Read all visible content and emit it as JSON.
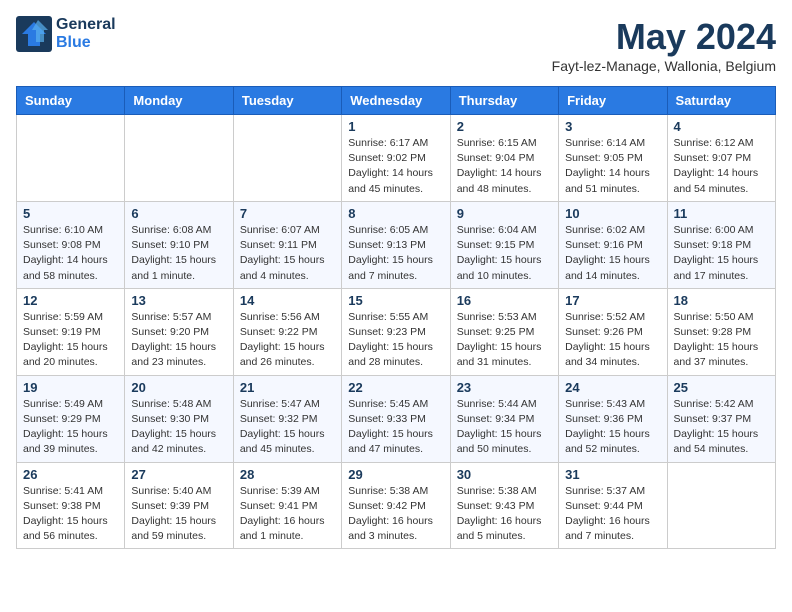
{
  "header": {
    "logo_general": "General",
    "logo_blue": "Blue",
    "month_title": "May 2024",
    "location": "Fayt-lez-Manage, Wallonia, Belgium"
  },
  "days_of_week": [
    "Sunday",
    "Monday",
    "Tuesday",
    "Wednesday",
    "Thursday",
    "Friday",
    "Saturday"
  ],
  "weeks": [
    [
      {
        "day": "",
        "info": ""
      },
      {
        "day": "",
        "info": ""
      },
      {
        "day": "",
        "info": ""
      },
      {
        "day": "1",
        "info": "Sunrise: 6:17 AM\nSunset: 9:02 PM\nDaylight: 14 hours\nand 45 minutes."
      },
      {
        "day": "2",
        "info": "Sunrise: 6:15 AM\nSunset: 9:04 PM\nDaylight: 14 hours\nand 48 minutes."
      },
      {
        "day": "3",
        "info": "Sunrise: 6:14 AM\nSunset: 9:05 PM\nDaylight: 14 hours\nand 51 minutes."
      },
      {
        "day": "4",
        "info": "Sunrise: 6:12 AM\nSunset: 9:07 PM\nDaylight: 14 hours\nand 54 minutes."
      }
    ],
    [
      {
        "day": "5",
        "info": "Sunrise: 6:10 AM\nSunset: 9:08 PM\nDaylight: 14 hours\nand 58 minutes."
      },
      {
        "day": "6",
        "info": "Sunrise: 6:08 AM\nSunset: 9:10 PM\nDaylight: 15 hours\nand 1 minute."
      },
      {
        "day": "7",
        "info": "Sunrise: 6:07 AM\nSunset: 9:11 PM\nDaylight: 15 hours\nand 4 minutes."
      },
      {
        "day": "8",
        "info": "Sunrise: 6:05 AM\nSunset: 9:13 PM\nDaylight: 15 hours\nand 7 minutes."
      },
      {
        "day": "9",
        "info": "Sunrise: 6:04 AM\nSunset: 9:15 PM\nDaylight: 15 hours\nand 10 minutes."
      },
      {
        "day": "10",
        "info": "Sunrise: 6:02 AM\nSunset: 9:16 PM\nDaylight: 15 hours\nand 14 minutes."
      },
      {
        "day": "11",
        "info": "Sunrise: 6:00 AM\nSunset: 9:18 PM\nDaylight: 15 hours\nand 17 minutes."
      }
    ],
    [
      {
        "day": "12",
        "info": "Sunrise: 5:59 AM\nSunset: 9:19 PM\nDaylight: 15 hours\nand 20 minutes."
      },
      {
        "day": "13",
        "info": "Sunrise: 5:57 AM\nSunset: 9:20 PM\nDaylight: 15 hours\nand 23 minutes."
      },
      {
        "day": "14",
        "info": "Sunrise: 5:56 AM\nSunset: 9:22 PM\nDaylight: 15 hours\nand 26 minutes."
      },
      {
        "day": "15",
        "info": "Sunrise: 5:55 AM\nSunset: 9:23 PM\nDaylight: 15 hours\nand 28 minutes."
      },
      {
        "day": "16",
        "info": "Sunrise: 5:53 AM\nSunset: 9:25 PM\nDaylight: 15 hours\nand 31 minutes."
      },
      {
        "day": "17",
        "info": "Sunrise: 5:52 AM\nSunset: 9:26 PM\nDaylight: 15 hours\nand 34 minutes."
      },
      {
        "day": "18",
        "info": "Sunrise: 5:50 AM\nSunset: 9:28 PM\nDaylight: 15 hours\nand 37 minutes."
      }
    ],
    [
      {
        "day": "19",
        "info": "Sunrise: 5:49 AM\nSunset: 9:29 PM\nDaylight: 15 hours\nand 39 minutes."
      },
      {
        "day": "20",
        "info": "Sunrise: 5:48 AM\nSunset: 9:30 PM\nDaylight: 15 hours\nand 42 minutes."
      },
      {
        "day": "21",
        "info": "Sunrise: 5:47 AM\nSunset: 9:32 PM\nDaylight: 15 hours\nand 45 minutes."
      },
      {
        "day": "22",
        "info": "Sunrise: 5:45 AM\nSunset: 9:33 PM\nDaylight: 15 hours\nand 47 minutes."
      },
      {
        "day": "23",
        "info": "Sunrise: 5:44 AM\nSunset: 9:34 PM\nDaylight: 15 hours\nand 50 minutes."
      },
      {
        "day": "24",
        "info": "Sunrise: 5:43 AM\nSunset: 9:36 PM\nDaylight: 15 hours\nand 52 minutes."
      },
      {
        "day": "25",
        "info": "Sunrise: 5:42 AM\nSunset: 9:37 PM\nDaylight: 15 hours\nand 54 minutes."
      }
    ],
    [
      {
        "day": "26",
        "info": "Sunrise: 5:41 AM\nSunset: 9:38 PM\nDaylight: 15 hours\nand 56 minutes."
      },
      {
        "day": "27",
        "info": "Sunrise: 5:40 AM\nSunset: 9:39 PM\nDaylight: 15 hours\nand 59 minutes."
      },
      {
        "day": "28",
        "info": "Sunrise: 5:39 AM\nSunset: 9:41 PM\nDaylight: 16 hours\nand 1 minute."
      },
      {
        "day": "29",
        "info": "Sunrise: 5:38 AM\nSunset: 9:42 PM\nDaylight: 16 hours\nand 3 minutes."
      },
      {
        "day": "30",
        "info": "Sunrise: 5:38 AM\nSunset: 9:43 PM\nDaylight: 16 hours\nand 5 minutes."
      },
      {
        "day": "31",
        "info": "Sunrise: 5:37 AM\nSunset: 9:44 PM\nDaylight: 16 hours\nand 7 minutes."
      },
      {
        "day": "",
        "info": ""
      }
    ]
  ]
}
